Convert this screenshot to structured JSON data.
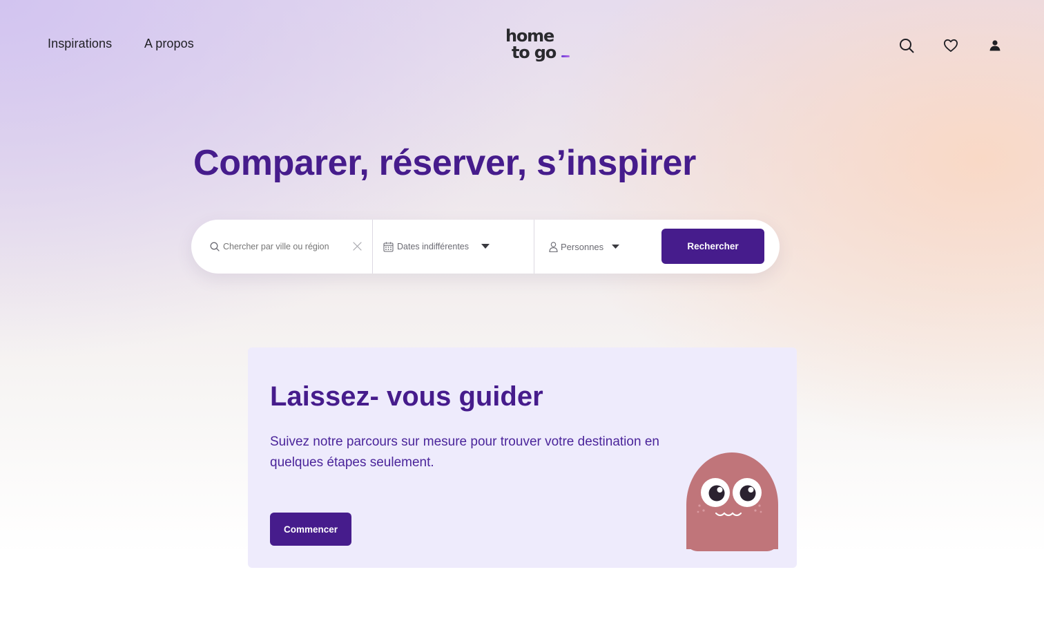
{
  "header": {
    "nav": [
      {
        "label": "Inspirations"
      },
      {
        "label": "A propos"
      }
    ],
    "logo": {
      "line1": "home",
      "line2": "to go"
    },
    "icons": [
      "search-icon",
      "heart-icon",
      "user-icon"
    ]
  },
  "hero": {
    "title": "Comparer, réserver, s’inspirer"
  },
  "search": {
    "destination_placeholder": "Chercher par ville ou région",
    "dates_label": "Dates indifférentes",
    "persons_label": "Personnes",
    "submit_label": "Rechercher"
  },
  "guide": {
    "title": "Laissez- vous guider",
    "description": "Suivez notre parcours sur mesure pour trouver votre destination en quelques étapes seulement.",
    "cta_label": "Commencer"
  },
  "colors": {
    "brand_purple": "#461c8c",
    "card_background": "#eeebfc",
    "mascot_pink": "#c0757a"
  }
}
